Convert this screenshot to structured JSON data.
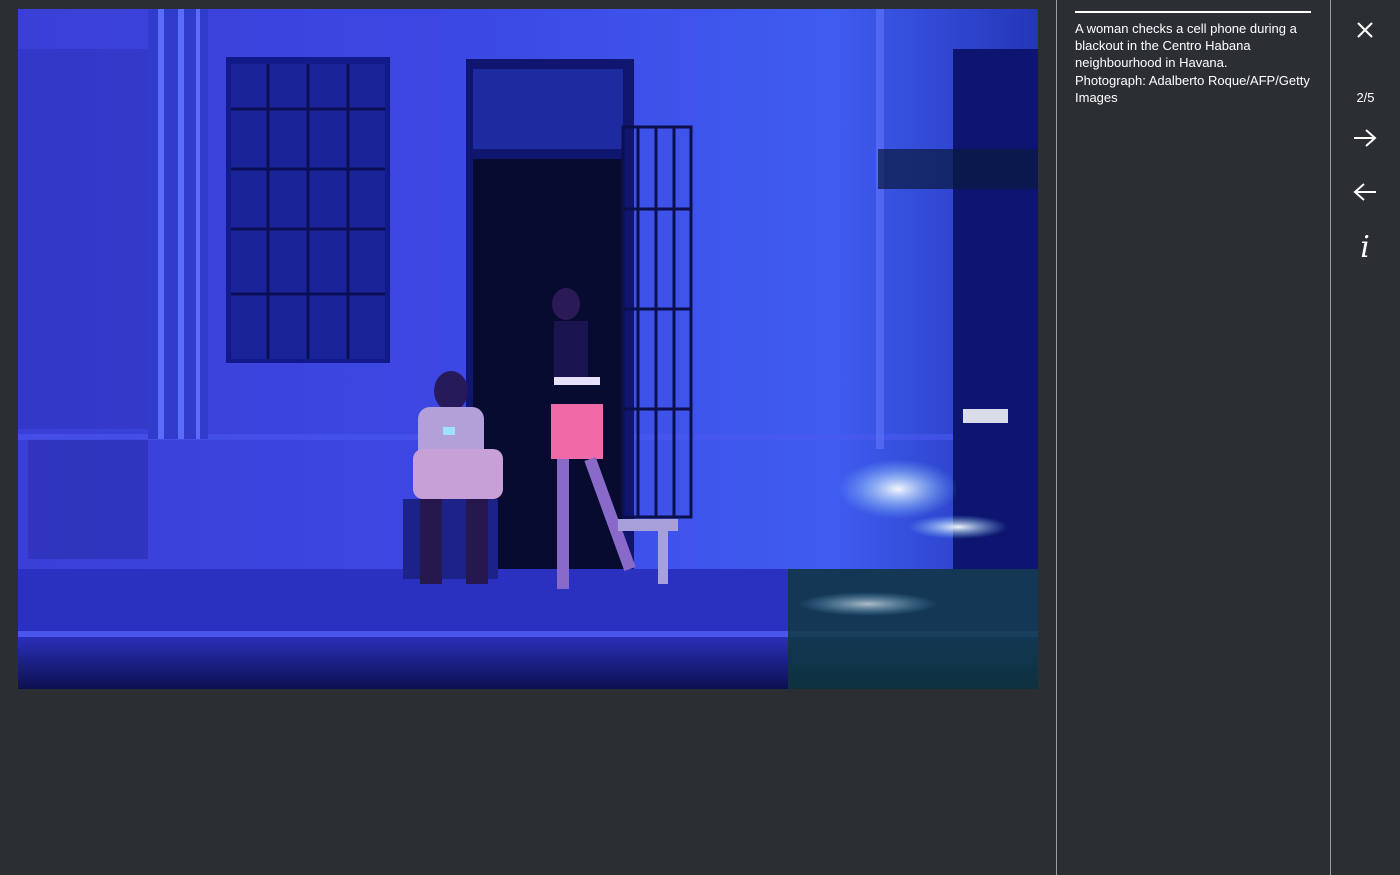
{
  "photo": {
    "alt": "A woman checks a cell phone during a blackout in the Centro Habana neighbourhood in Havana."
  },
  "caption": {
    "text": "A woman checks a cell phone during a blackout in the Centro Habana neighbourhood in Havana.",
    "credit": "Photograph: Adalberto Roque/AFP/Getty Images"
  },
  "controls": {
    "counter": "2/5",
    "close_icon": "close-icon",
    "next_icon": "arrow-right-icon",
    "prev_icon": "arrow-left-icon",
    "info_icon": "info-icon",
    "info_glyph": "i"
  },
  "colors": {
    "background": "#2b2f33",
    "text": "#ffffff",
    "divider": "#9a9ea3"
  }
}
